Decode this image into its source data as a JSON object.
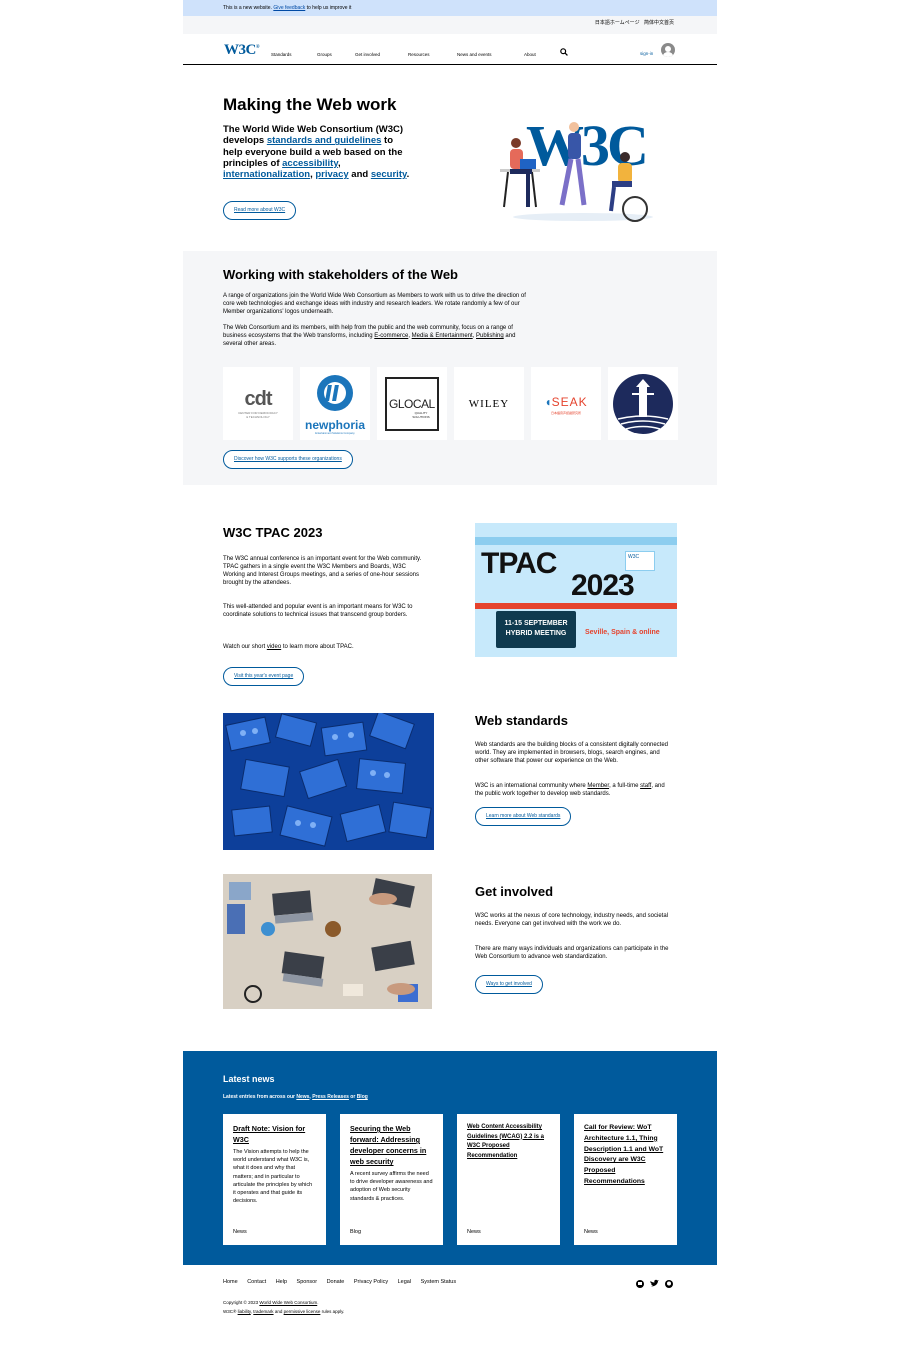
{
  "banner": {
    "prefix": "This is a new website.",
    "link": "Give feedback",
    "suffix": "to help us improve it"
  },
  "lang": {
    "ja": "日本語ホームページ",
    "zh": "简体中文首页"
  },
  "nav": {
    "logo": "W3C",
    "items": [
      "Standards",
      "Groups",
      "Get involved",
      "Resources",
      "News and events",
      "About"
    ],
    "sign_in": "sign-in",
    "search_icon": "search-icon",
    "avatar_icon": "user-icon"
  },
  "hero": {
    "title": "Making the Web work",
    "intro_1": "The World Wide Web Consortium (W3C) develops",
    "link_1": "standards and guidelines",
    "intro_2": "to help everyone build a web based on the principles of",
    "link_2": "accessibility",
    "link_3": "internationalization",
    "link_4": "privacy",
    "and": "and",
    "link_5": "security",
    "button": "Read more about W3C"
  },
  "stakeholders": {
    "title": "Working with stakeholders of the Web",
    "p1": "A range of organizations join the World Wide Web Consortium as Members to work with us to drive the direction of core web technologies and exchange ideas with industry and research leaders. We rotate randomly a few of our Member organizations' logos underneath.",
    "p2a": "The Web Consortium and its members, with help from the public and the web community, focus on a range of business ecosystems that the Web transforms, including",
    "link_a": "E-commerce",
    "link_b": "Media & Entertainment",
    "link_c": "Publishing",
    "p2b": "and several other areas.",
    "logos": {
      "cdt": "cdt",
      "cdt_sub": "CENTER FOR DEMOCRACY & TECHNOLOGY",
      "newphoria": "newphoria",
      "newphoria_sub": "Entertainment Solutions Company",
      "glocal": "GLOCAL",
      "glocal_sub": "QUALITY SOLUTIONS",
      "wiley": "WILEY",
      "seak": "SEAK",
      "seak_sub": "日本語音声認識研究所"
    },
    "button": "Discover how W3C supports these organizations"
  },
  "tpac": {
    "title": "W3C TPAC 2023",
    "p1": "The W3C annual conference is an important event for the Web community. TPAC gathers in a single event the W3C Members and Boards, W3C Working and Interest Groups meetings, and a series of one-hour sessions brought by the attendees.",
    "p2": "This well-attended and popular event is an important means for W3C to coordinate solutions to technical issues that transcend group borders.",
    "p3a": "Watch our short",
    "p3_link": "video",
    "p3b": "to learn more about TPAC.",
    "button": "Visit this year's event page",
    "image": {
      "big1": "TPAC",
      "big2": "2023",
      "dates": "11-15 SEPTEMBER",
      "mode": "HYBRID MEETING",
      "location": "Seville, Spain & online",
      "logo": "W3C"
    }
  },
  "web_standards": {
    "title": "Web standards",
    "p1": "Web standards are the building blocks of a consistent digitally connected world. They are implemented in browsers, blogs, search engines, and other software that power our experience on the Web.",
    "p2a": "W3C is an international community where",
    "p2_link1": "Member",
    "p2b": ", a full-time",
    "p2_link2": "staff",
    "p2c": ", and the public work together to develop web standards.",
    "button": "Learn more about Web standards"
  },
  "get_involved": {
    "title": "Get involved",
    "p1": "W3C works at the nexus of core technology, industry needs, and societal needs. Everyone can get involved with the work we do.",
    "p2": "There are many ways individuals and organizations can participate in the Web Consortium to advance web standardization.",
    "button": "Ways to get involved"
  },
  "news": {
    "title": "Latest news",
    "sub_prefix": "Latest entries from across our",
    "sub_link1": "News",
    "sub_link2": "Press Releases",
    "sub_or": "or",
    "sub_link3": "Blog",
    "cards": [
      {
        "title": "Draft Note: Vision for W3C",
        "desc": "The Vision attempts to help the world understand what W3C is, what it does and why that matters; and in particular to articulate the principles by which it operates and that guide its decisions.",
        "category": "News"
      },
      {
        "title": "Securing the Web forward: Addressing developer concerns in web security",
        "desc": "A recent survey affirms the need to drive developer awareness and adoption of Web security standards & practices.",
        "category": "Blog"
      },
      {
        "title": "Web Content Accessibility Guidelines (WCAG) 2.2 is a W3C Proposed Recommendation",
        "desc": "",
        "category": "News"
      },
      {
        "title": "Call for Review: WoT Architecture 1.1, Thing Description 1.1 and WoT Discovery are W3C Proposed Recommendations",
        "desc": "",
        "category": "News"
      }
    ]
  },
  "footer": {
    "links": [
      "Home",
      "Contact",
      "Help",
      "Sponsor",
      "Donate",
      "Privacy Policy",
      "Legal",
      "System Status"
    ],
    "copy_prefix": "Copyright © 2023",
    "copy_link": "World Wide Web Consortium",
    "copy_suffix": ".",
    "line2_prefix": "W3C®",
    "line2_link1": "liability",
    "line2_sep": ",",
    "line2_link2": "trademark",
    "line2_and": "and",
    "line2_link3": "permissive license",
    "line2_suffix": "rules apply.",
    "social": [
      "mastodon-icon",
      "twitter-icon",
      "github-icon"
    ]
  },
  "colors": {
    "brand": "#005a9c",
    "banner": "#cfe2fb",
    "section_bg": "#f5f6f8"
  }
}
